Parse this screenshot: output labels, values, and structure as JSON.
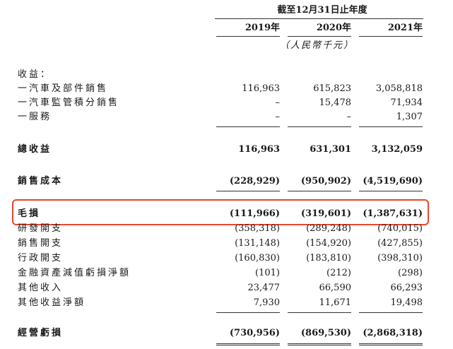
{
  "header": {
    "period_title": "截至12月31日止年度",
    "years": [
      "2019年",
      "2020年",
      "2021年"
    ],
    "unit": "（人民幣千元）"
  },
  "section_label": "收益：",
  "revenue_items": [
    {
      "label": "一汽車及部件銷售",
      "v2019": "116,963",
      "v2020": "615,823",
      "v2021": "3,058,818"
    },
    {
      "label": "一汽車監管積分銷售",
      "v2019": "–",
      "v2020": "15,478",
      "v2021": "71,934"
    },
    {
      "label": "一服務",
      "v2019": "–",
      "v2020": "–",
      "v2021": "1,307"
    }
  ],
  "total_revenue": {
    "label": "總收益",
    "v2019": "116,963",
    "v2020": "631,301",
    "v2021": "3,132,059"
  },
  "cost_of_sales": {
    "label": "銷售成本",
    "v2019": "(228,929)",
    "v2020": "(950,902)",
    "v2021": "(4,519,690)"
  },
  "gross_loss": {
    "label": "毛損",
    "v2019": "(111,966)",
    "v2020": "(319,601)",
    "v2021": "(1,387,631)"
  },
  "expense_items": [
    {
      "label": "研發開支",
      "v2019": "(358,318)",
      "v2020": "(289,248)",
      "v2021": "(740,015)"
    },
    {
      "label": "銷售開支",
      "v2019": "(131,148)",
      "v2020": "(154,920)",
      "v2021": "(427,855)"
    },
    {
      "label": "行政開支",
      "v2019": "(160,830)",
      "v2020": "(183,810)",
      "v2021": "(398,310)"
    },
    {
      "label": "金融資產減值虧損淨額",
      "v2019": "(101)",
      "v2020": "(212)",
      "v2021": "(298)"
    },
    {
      "label": "其他收入",
      "v2019": "23,477",
      "v2020": "66,590",
      "v2021": "66,293"
    },
    {
      "label": "其他收益淨額",
      "v2019": "7,930",
      "v2020": "11,671",
      "v2021": "19,498"
    }
  ],
  "operating_loss": {
    "label": "經營虧損",
    "v2019": "(730,956)",
    "v2020": "(869,530)",
    "v2021": "(2,868,318)"
  },
  "highlight_color": "#e8472e"
}
